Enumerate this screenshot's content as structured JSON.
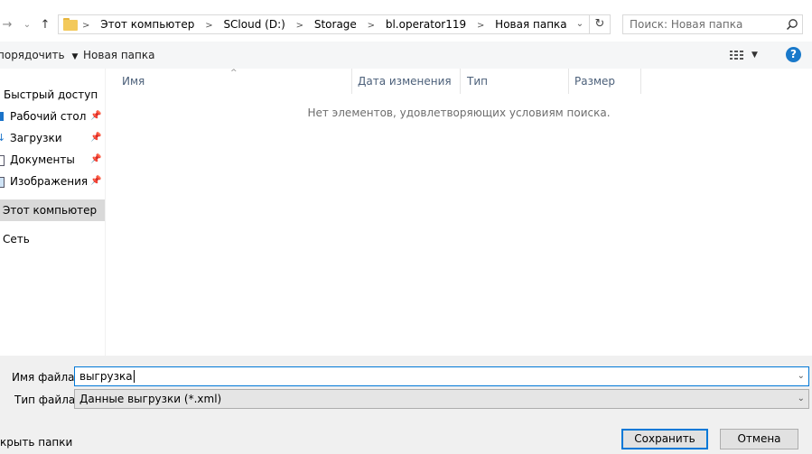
{
  "address": {
    "crumbs": [
      "Этот компьютер",
      "SCloud (D:)",
      "Storage",
      "bl.operator119",
      "Новая папка"
    ]
  },
  "search": {
    "placeholder": "Поиск: Новая папка"
  },
  "toolbar": {
    "organize_label": "порядочить",
    "new_folder_label": "Новая папка"
  },
  "nav": {
    "quick_access": "Быстрый доступ",
    "items": [
      {
        "label": "Рабочий стол"
      },
      {
        "label": "Загрузки"
      },
      {
        "label": "Документы"
      },
      {
        "label": "Изображения"
      }
    ],
    "this_pc": "Этот компьютер",
    "network": "Сеть"
  },
  "columns": {
    "name": "Имя",
    "date": "Дата изменения",
    "type": "Тип",
    "size": "Размер"
  },
  "empty_message": "Нет элементов, удовлетворяющих условиям поиска.",
  "form": {
    "filename_label": "Имя файла:",
    "filename_value": "выгрузка",
    "filetype_label": "Тип файла:",
    "filetype_value": "Данные выгрузки (*.xml)"
  },
  "buttons": {
    "hide_folders": "крыть папки",
    "save": "Сохранить",
    "cancel": "Отмена"
  },
  "colors": {
    "accent": "#0078d7",
    "help": "#1979ca",
    "selected": "#d9d9d9"
  }
}
